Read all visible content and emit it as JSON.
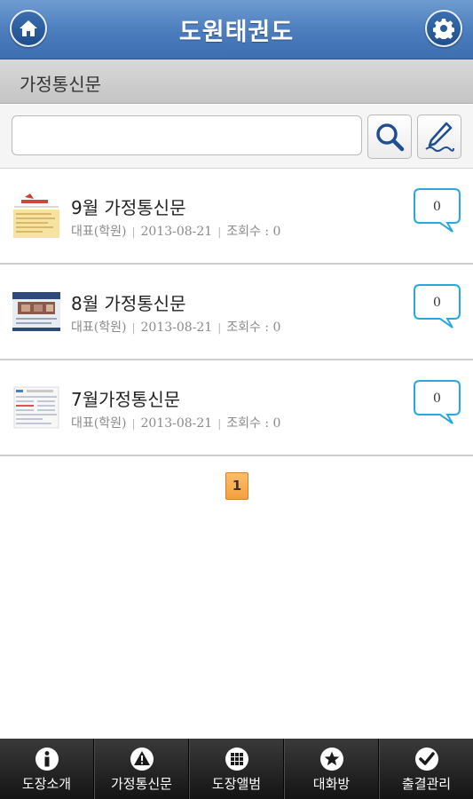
{
  "header": {
    "title": "도원태권도",
    "home_icon": "home-icon",
    "settings_icon": "gear-icon"
  },
  "section": {
    "title": "가정통신문"
  },
  "search": {
    "value": "",
    "placeholder": "",
    "search_icon": "search-icon",
    "write_icon": "pen-icon"
  },
  "posts": [
    {
      "title": "9월 가정통신문",
      "author": "대표(학원)",
      "date": "2013-08-21",
      "views": "조회수 : 0",
      "comments": "0"
    },
    {
      "title": "8월 가정통신문",
      "author": "대표(학원)",
      "date": "2013-08-21",
      "views": "조회수 : 0",
      "comments": "0"
    },
    {
      "title": "7월가정통신문",
      "author": "대표(학원)",
      "date": "2013-08-21",
      "views": "조회수 : 0",
      "comments": "0"
    }
  ],
  "pagination": {
    "current": "1"
  },
  "tabs": [
    {
      "label": "도장소개",
      "icon": "info-icon"
    },
    {
      "label": "가정통신문",
      "icon": "warning-icon"
    },
    {
      "label": "도장앨범",
      "icon": "grid-icon"
    },
    {
      "label": "대화방",
      "icon": "star-icon"
    },
    {
      "label": "출결관리",
      "icon": "check-icon"
    }
  ],
  "colors": {
    "header": "#4d7fbf",
    "bubble_border": "#29a8e0",
    "pager": "#f7a84b",
    "tabbar": "#222222"
  }
}
